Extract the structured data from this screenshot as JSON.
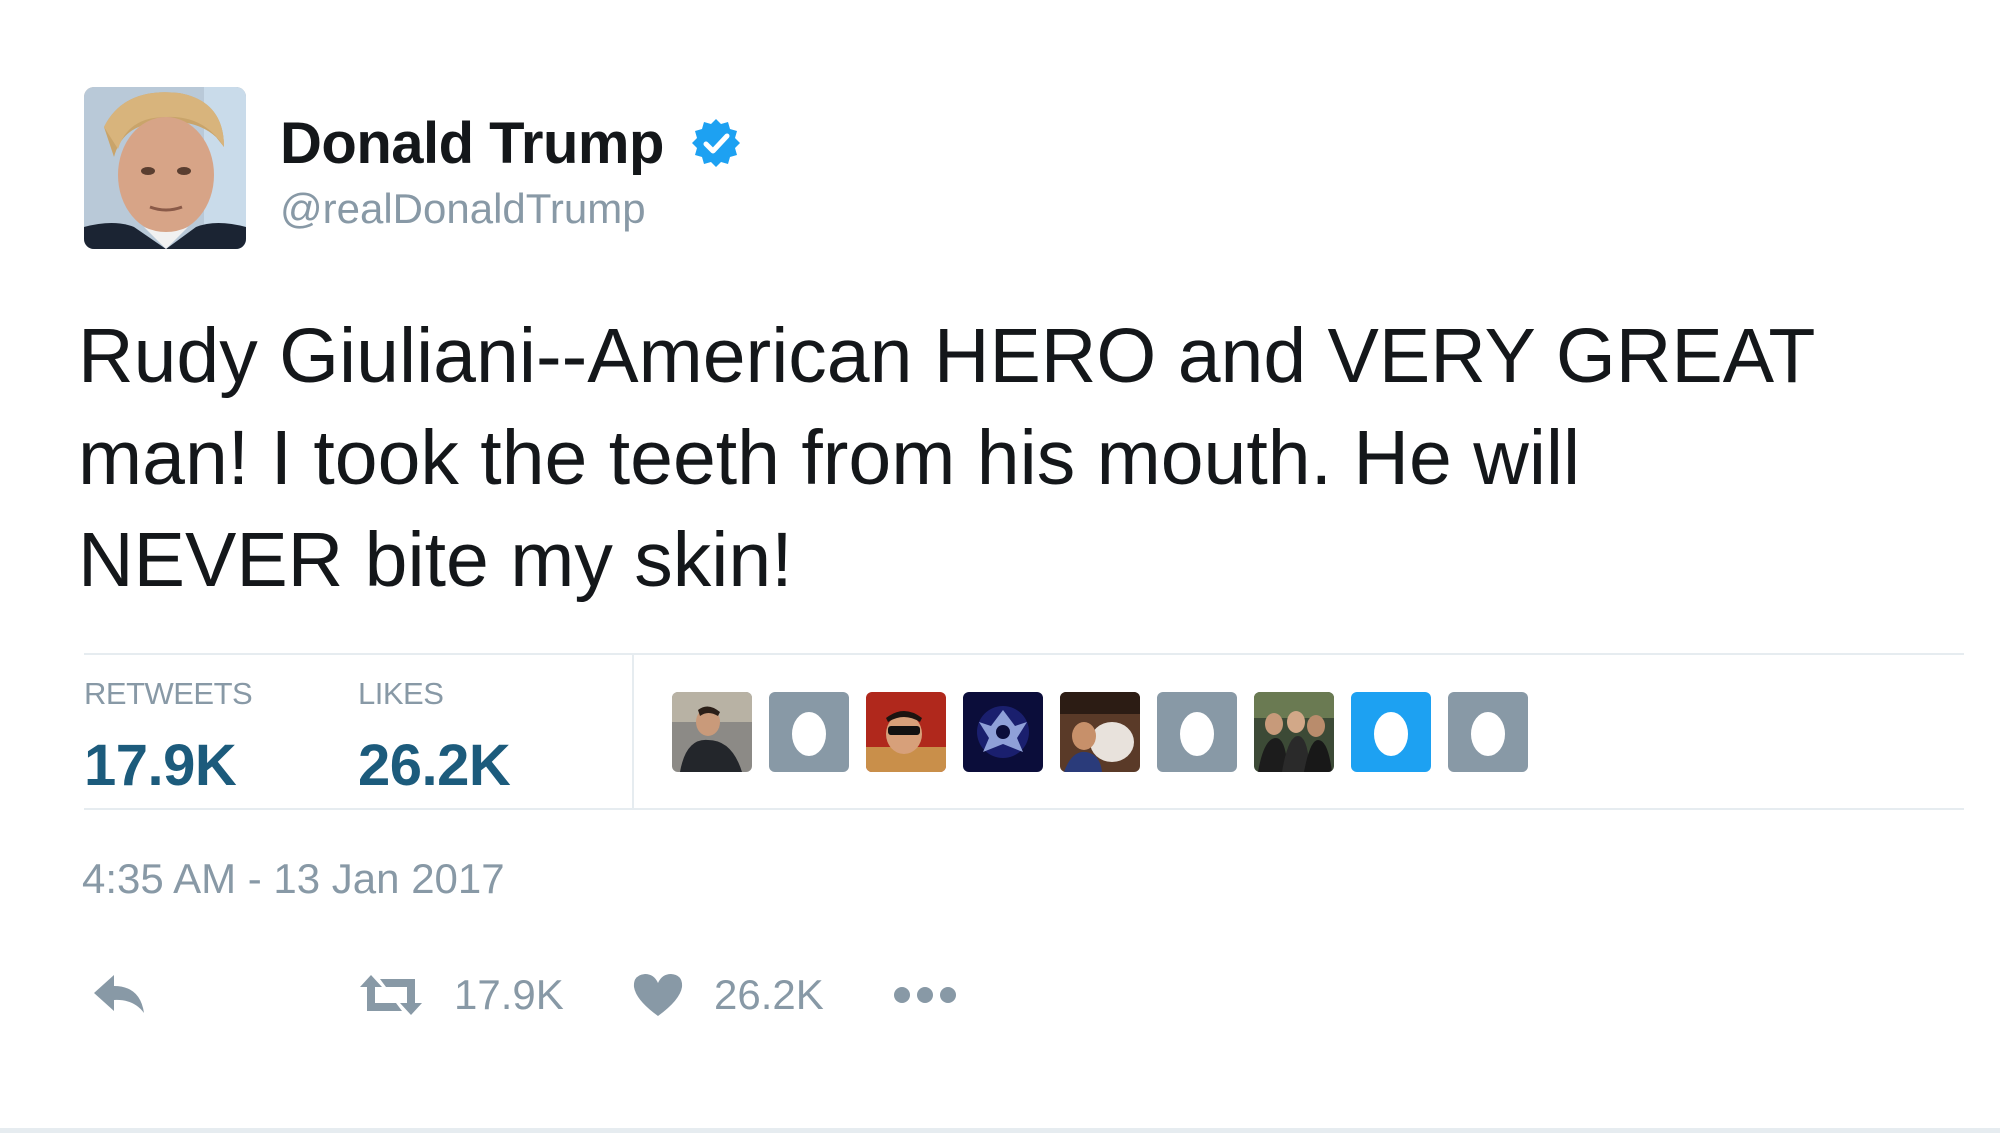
{
  "author": {
    "name": "Donald Trump",
    "handle": "@realDonaldTrump",
    "verified": true,
    "avatar_icon": "profile-photo"
  },
  "tweet": {
    "text": "Rudy Giuliani--American HERO and VERY GREAT\nman! I took the teeth from his mouth. He will\nNEVER bite my skin!",
    "timestamp": "4:35 AM - 13 Jan 2017"
  },
  "stats": {
    "retweets_label": "RETWEETS",
    "retweets_value": "17.9K",
    "likes_label": "LIKES",
    "likes_value": "26.2K"
  },
  "likers": [
    {
      "icon": "liker-photo-man-jacket"
    },
    {
      "icon": "default-egg-avatar"
    },
    {
      "icon": "liker-photo-red-background"
    },
    {
      "icon": "liker-photo-dark-emblem"
    },
    {
      "icon": "liker-photo-brown"
    },
    {
      "icon": "default-egg-avatar"
    },
    {
      "icon": "liker-photo-group"
    },
    {
      "icon": "default-egg-avatar-blue"
    },
    {
      "icon": "default-egg-avatar"
    }
  ],
  "actions": {
    "reply_icon": "reply-icon",
    "retweet_icon": "retweet-icon",
    "retweet_count": "17.9K",
    "like_icon": "heart-icon",
    "like_count": "26.2K",
    "more_icon": "more-dots-icon"
  },
  "colors": {
    "text_primary": "#14171a",
    "text_secondary": "#8899a6",
    "stat_value": "#1c5b7c",
    "verified_blue": "#1da1f2",
    "divider": "#e6ecf0",
    "egg_gray": "#8899a6",
    "egg_blue": "#1da1f2"
  }
}
